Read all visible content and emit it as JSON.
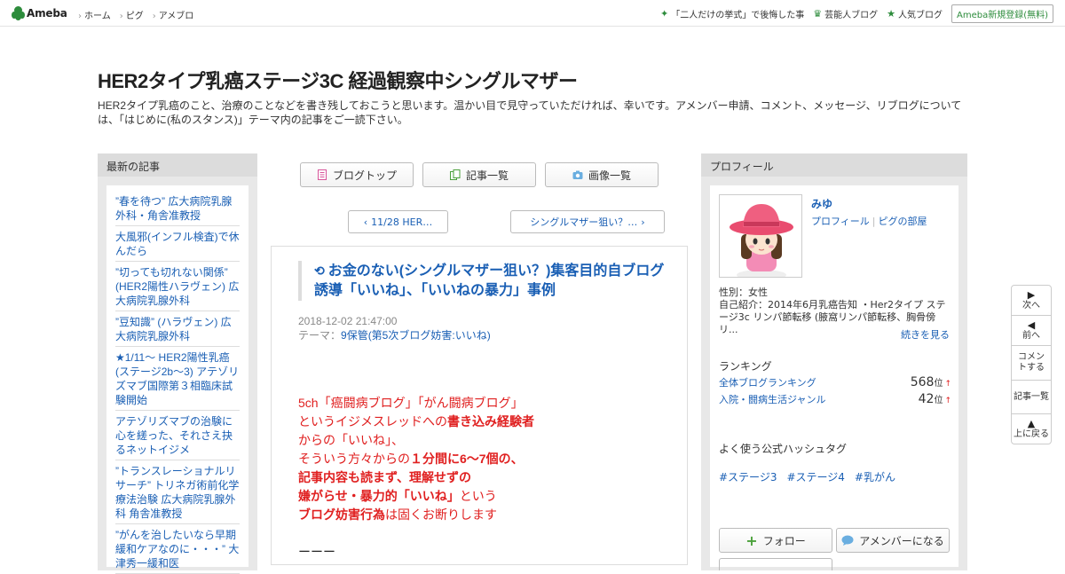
{
  "topbar": {
    "logo_text": "Ameba",
    "nav": [
      "ホーム",
      "ピグ",
      "アメブロ"
    ],
    "right_links": [
      "「二人だけの挙式」で後悔した事",
      "芸能人ブログ",
      "人気ブログ"
    ],
    "signup": "Ameba新規登録(無料)"
  },
  "header": {
    "title": "HER2タイプ乳癌ステージ3C 経過観察中シングルマザー",
    "description": "HER2タイプ乳癌のこと、治療のことなどを書き残しておこうと思います。温かい目で見守っていただければ、幸いです。アメンバー申請、コメント、メッセージ、リブログについては、「はじめに(私のスタンス)」テーマ内の記事をご一読下さい。"
  },
  "left_sidebar": {
    "heading": "最新の記事",
    "items": [
      "”春を待つ” 広大病院乳腺外科・角舎准教授",
      "大風邪(インフル検査)で休んだら",
      "”切っても切れない関係” (HER2陽性ハラヴェン) 広大病院乳腺外科",
      "”豆知識” (ハラヴェン) 広大病院乳腺外科",
      "★1/11～ HER2陽性乳癌(ステージ2b～3) アテゾリズマブ国際第３相臨床試験開始",
      "アテゾリズマブの治験に心を縒った、それさえ抉るネットイジメ",
      "”トランスレーショナルリサーチ” トリネガ術前化学療法治験 広大病院乳腺外科 角舎准教授",
      "”がんを治したいなら早期緩和ケアなのに・・・” 大津秀一緩和医"
    ]
  },
  "center": {
    "buttons": [
      "ブログトップ",
      "記事一覧",
      "画像一覧"
    ],
    "prev": "11/28 HER…",
    "next": "シングルマザー狙い？…",
    "entry": {
      "title": "お金のない(シングルマザー狙い？)集客目的自ブログ誘導「いいね」、「いいねの暴力」事例",
      "date": "2018-12-02 21:47:00",
      "theme_label": "テーマ：",
      "theme": "9保管(第5次ブログ妨害:いいね)",
      "body": {
        "l1": "5ch「癌闘病ブログ」「がん闘病ブログ」",
        "l2a": "というイジメスレッドへの",
        "l2b": "書き込み経験者",
        "l3": "からの「いいね」、",
        "l4a": "そういう方々からの",
        "l4b": "１分間に6～7個の、",
        "l5": "記事内容も読まず、理解せずの",
        "l6a": "嫌がらせ・暴力的「いいね」",
        "l6b": "という",
        "l7a": "ブログ妨害行為",
        "l7b": "は固くお断りします",
        "dash": "ーーー"
      }
    }
  },
  "right_sidebar": {
    "heading": "プロフィール",
    "name": "みゆ",
    "link_profile": "プロフィール",
    "link_room": "ピグの部屋",
    "gender": "性別：女性",
    "intro": "自己紹介：2014年6月乳癌告知 ・Her2タイプ ステージ3c リンパ節転移 (腋窩リンパ節転移、胸骨傍リ...",
    "more": "続きを見る",
    "ranking_title": "ランキング",
    "rankings": [
      {
        "name": "全体ブログランキング",
        "value": "568",
        "unit": "位"
      },
      {
        "name": "入院・闘病生活ジャンル",
        "value": "42",
        "unit": "位"
      }
    ],
    "hashtag_title": "よく使う公式ハッシュタグ",
    "hashtags": [
      "#ステージ3",
      "#ステージ4",
      "#乳がん"
    ],
    "follow": "フォロー",
    "amember": "アメンバーになる"
  },
  "float_nav": {
    "next": "次へ",
    "prev": "前へ",
    "comment": "コメントする",
    "list": "記事一覧",
    "top": "上に戻る"
  },
  "colors": {
    "link": "#1a5fb4",
    "accent_red": "#e02020",
    "brand_green": "#2d8c3c"
  }
}
